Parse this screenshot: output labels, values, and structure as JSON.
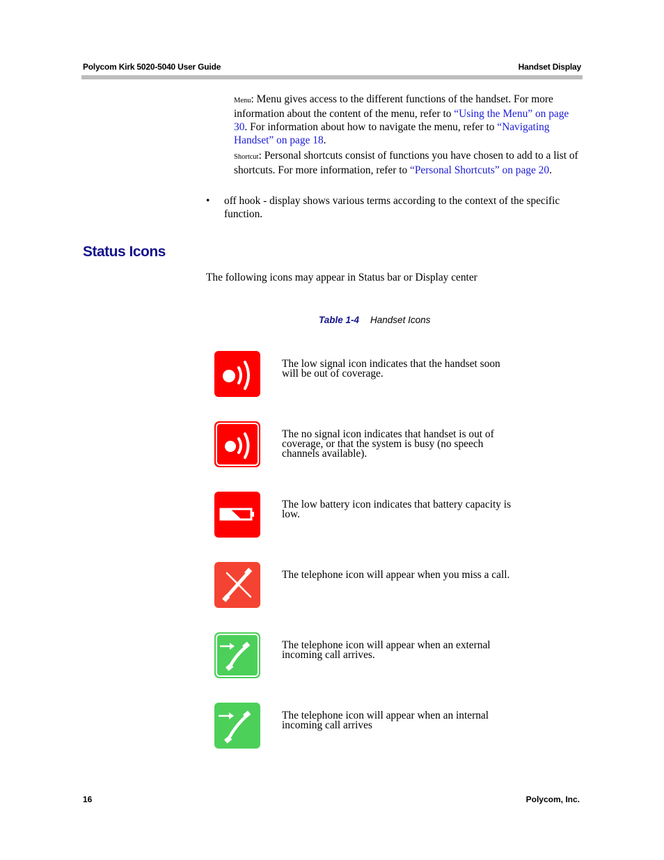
{
  "header": {
    "doc_title": "Polycom Kirk 5020-5040 User Guide",
    "section_title": "Handset Display"
  },
  "menu_para": {
    "term": "Menu",
    "text1": ": Menu gives access to the different functions of the handset. For more information about the content of the menu, refer to ",
    "link1": "“Using the Menu” on page 30",
    "text2": ". For information about how to navigate the menu, refer to ",
    "link2": "“Navigating Handset” on page 18",
    "text3": "."
  },
  "shortcut_para": {
    "term": "Shortcut",
    "text1": ": Personal shortcuts consist of functions you have chosen to add to a list of shortcuts. For more information, refer to ",
    "link1": "“Personal Shortcuts” on page 20",
    "text2": "."
  },
  "bullet": {
    "symbol": "•",
    "text": "off hook - display shows various terms according to the context of the specific function."
  },
  "section": {
    "heading": "Status Icons",
    "intro": "The following icons may appear in Status bar or Display center"
  },
  "table": {
    "caption_number": "Table 1-4",
    "caption_title": "Handset Icons",
    "rows": [
      {
        "icon": "low-signal-icon",
        "color": "#ff0000",
        "description": "The low signal icon indicates that the handset soon will be out of coverage."
      },
      {
        "icon": "no-signal-icon",
        "color": "#ff0000",
        "description": "The no signal icon indicates that handset is out of coverage, or that the system is busy (no speech channels available)."
      },
      {
        "icon": "low-battery-icon",
        "color": "#ff0000",
        "description": "The low battery icon indicates that battery capacity is low."
      },
      {
        "icon": "missed-call-icon",
        "color": "#f44332",
        "description": "The telephone icon will appear when you miss a call."
      },
      {
        "icon": "external-incoming-call-icon",
        "color": "#4cd05a",
        "description": "The telephone icon will appear when an external incoming call arrives."
      },
      {
        "icon": "internal-incoming-call-icon",
        "color": "#4cd05a",
        "description": "The telephone icon will appear when an internal incoming call arrives"
      }
    ]
  },
  "footer": {
    "page_number": "16",
    "company": "Polycom, Inc."
  }
}
